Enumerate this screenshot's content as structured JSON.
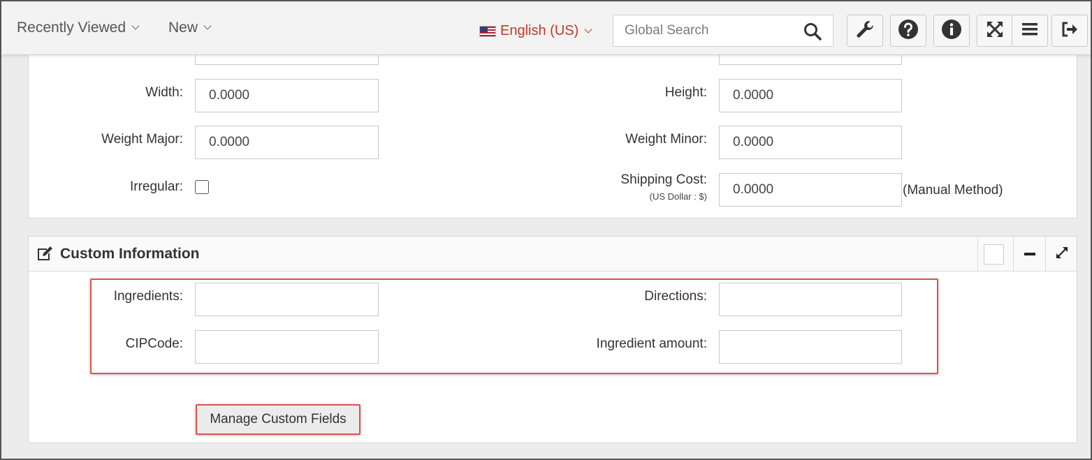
{
  "topbar": {
    "recently_viewed": "Recently Viewed",
    "new": "New",
    "language": "English (US)",
    "search_placeholder": "Global Search",
    "icons": [
      "wrench-icon",
      "help-icon",
      "info-icon",
      "fullscreen-icon",
      "menu-icon",
      "logout-icon"
    ]
  },
  "dimensions": {
    "width_label": "Width:",
    "width_value": "0.0000",
    "height_label": "Height:",
    "height_value": "0.0000",
    "weight_major_label": "Weight Major:",
    "weight_major_value": "0.0000",
    "weight_minor_label": "Weight Minor:",
    "weight_minor_value": "0.0000",
    "irregular_label": "Irregular:",
    "shipping_cost_label": "Shipping Cost:",
    "shipping_cost_sublabel": "(US Dollar : $)",
    "shipping_cost_value": "0.0000",
    "manual_method": "(Manual Method)"
  },
  "custom_info": {
    "title": "Custom Information",
    "ingredients_label": "Ingredients:",
    "directions_label": "Directions:",
    "cipcode_label": "CIPCode:",
    "ingredient_amount_label": "Ingredient amount:",
    "manage_button": "Manage Custom Fields"
  },
  "colors": {
    "accent_red": "#d9534f",
    "language_red": "#c0392b"
  }
}
